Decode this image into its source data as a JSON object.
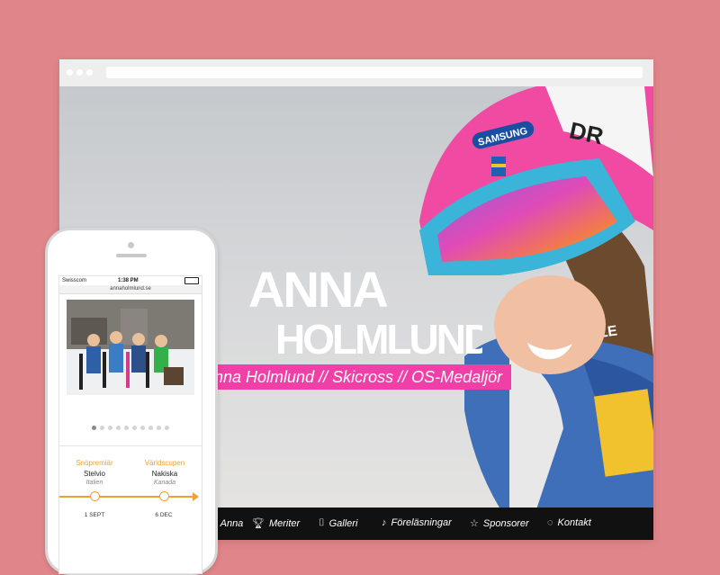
{
  "site": {
    "url": "annaholmlund.se",
    "tagline": "Anna Holmlund // Skicross // OS-Medaljör",
    "logo_line1": "ANNA",
    "logo_line2": "HOLMLUND"
  },
  "nav": {
    "items": [
      {
        "label": "Anna",
        "icon": "person-icon"
      },
      {
        "label": "Meriter",
        "icon": "trophy-icon"
      },
      {
        "label": "Galleri",
        "icon": "camera-icon"
      },
      {
        "label": "Föreläsningar",
        "icon": "microphone-icon"
      },
      {
        "label": "Sponsorer",
        "icon": "star-icon"
      },
      {
        "label": "Kontakt",
        "icon": "chat-icon"
      }
    ]
  },
  "phone": {
    "status": {
      "carrier": "Swisscom",
      "time": "1:38 PM"
    },
    "address": "annaholmlund.se",
    "carousel_dots": 10,
    "carousel_active": 0,
    "events": [
      {
        "type": "Snöpremiär",
        "name": "Stelvio",
        "place": "Italien",
        "date": "1 SEPT"
      },
      {
        "type": "Världscupen",
        "name": "Nakiska",
        "place": "Kanada",
        "date": "6 DEC"
      }
    ]
  },
  "colors": {
    "background": "#e0868a",
    "accent_pink": "#f03fa7",
    "accent_orange": "#f0a036",
    "nav_bg": "#111111"
  }
}
